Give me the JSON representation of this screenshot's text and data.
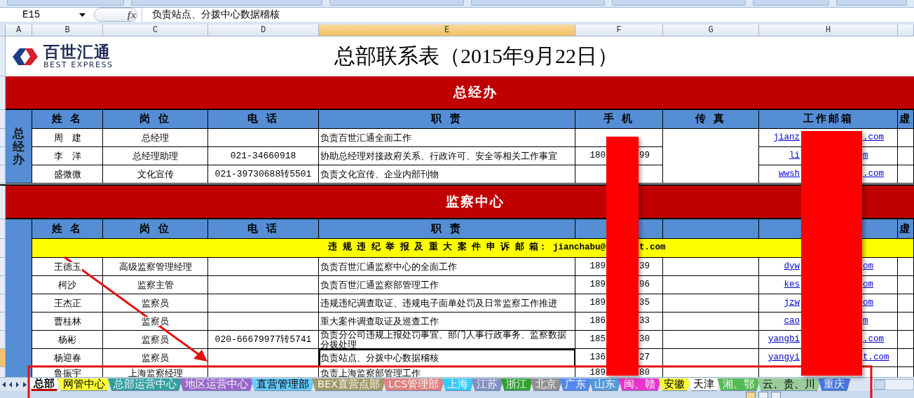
{
  "formula_bar": {
    "cell_ref": "E15",
    "fx": "fx",
    "content": "负责站点、分拨中心数据稽核"
  },
  "columns": [
    {
      "label": "A",
      "selected": false
    },
    {
      "label": "B",
      "selected": false
    },
    {
      "label": "C",
      "selected": false
    },
    {
      "label": "D",
      "selected": false
    },
    {
      "label": "E",
      "selected": true
    },
    {
      "label": "F",
      "selected": false
    },
    {
      "label": "G",
      "selected": false
    },
    {
      "label": "H",
      "selected": false
    }
  ],
  "logo": {
    "name": "百世汇通",
    "tagline": "BEST EXPRESS"
  },
  "title": "总部联系表（2015年9月22日）",
  "sections": [
    {
      "kind": "office",
      "title": "总经办",
      "side_label": "总经办",
      "headers": {
        "name": "姓 名",
        "position": "岗 位",
        "phone": "电 话",
        "duty": "职 责",
        "mobile": "手 机",
        "fax": "传 真",
        "email": "工作邮箱",
        "column_i": "虚"
      },
      "rows": [
        {
          "name": "周　建",
          "position": "总经理",
          "duty": "负责百世汇通全面工作",
          "email": [
            "jianz",
            ".com"
          ],
          "selected": false
        },
        {
          "name": "李　洋",
          "position": "总经理助理",
          "phone": "021-34660918",
          "duty": "协助总经理对接政府关系、行政许可、安全等相关工作事宜",
          "mobile": [
            "180",
            "99"
          ],
          "email": [
            "li",
            "m"
          ],
          "selected": false
        },
        {
          "name": "盛微微",
          "position": "文化宣传",
          "phone": "021-39730688转5501",
          "duty": "负责文化宣传、企业内部刊物",
          "email": [
            "wwsh",
            ".com"
          ],
          "selected": false
        }
      ]
    },
    {
      "kind": "supervision",
      "title": "监察中心",
      "headers": {
        "name": "姓 名",
        "position": "岗 位",
        "phone": "电 话",
        "duty": "职 责",
        "column_i": "虚"
      },
      "notice": [
        "违 规 违 纪 举 报 及 重 大 案 件 申 诉 邮 箱： jianchabu@",
        "t.com"
      ],
      "rows": [
        {
          "name": "王德玉",
          "position": "高级监察管理经理",
          "duty": "负责百世汇通监察中心的全面工作",
          "mobile": [
            "189",
            "39"
          ],
          "email": [
            "dyw",
            "om"
          ],
          "selected": false
        },
        {
          "name": "柯沙",
          "position": "监察主管",
          "duty": "负责百世汇通监察部管理工作",
          "mobile": [
            "189",
            "96"
          ],
          "email": [
            "kes",
            "om"
          ],
          "selected": false
        },
        {
          "name": "王杰正",
          "position": "监察员",
          "duty": "违规违纪调查取证、违规电子面单处罚及日常监察工作推进",
          "mobile": [
            "189",
            "35"
          ],
          "email": [
            "jzw",
            "om"
          ],
          "selected": false
        },
        {
          "name": "曹桂林",
          "position": "监察员",
          "duty": "重大案件调查取证及巡查工作",
          "mobile": [
            "186",
            "33"
          ],
          "email": [
            "cao",
            "m"
          ],
          "selected": false
        },
        {
          "name": "杨彬",
          "position": "监察员",
          "phone": "020-66679977转5741",
          "duty": "负责分公司违规上报处罚事宜、部门人事行政事务、监察数据分拨处理",
          "mobile": [
            "185",
            "30"
          ],
          "email": [
            "yangbi",
            ".com"
          ],
          "selected": false
        },
        {
          "name": "杨迎春",
          "position": "监察员",
          "duty": "负责站点、分拨中心数据稽核",
          "mobile": [
            "136",
            "27"
          ],
          "email": [
            "yangyi",
            "t.com"
          ],
          "selected": true
        },
        {
          "name": "鲁振宇",
          "position": "上海监察经理",
          "duty": "负责上海监察部管理工作",
          "mobile": [
            "189",
            "80"
          ],
          "selected": false
        }
      ]
    }
  ],
  "tabs": [
    {
      "label": "总部",
      "color": "#ffffff",
      "selected": true
    },
    {
      "label": "网管中心",
      "color": "#ffff33",
      "selected": false
    },
    {
      "label": "总部运营中心",
      "color": "#33a0a0",
      "selected": false
    },
    {
      "label": "地区运营中心",
      "color": "#9966cc",
      "selected": false
    },
    {
      "label": "直营管理部",
      "color": "#66ccff",
      "selected": false
    },
    {
      "label": "BEX直营点部",
      "color": "#a09a66",
      "selected": false
    },
    {
      "label": "LCS管理部",
      "color": "#e08080",
      "selected": false
    },
    {
      "label": "上海",
      "color": "#33ccff",
      "selected": false
    },
    {
      "label": "江苏",
      "color": "#8090c0",
      "selected": false
    },
    {
      "label": "浙江",
      "color": "#33a033",
      "selected": false
    },
    {
      "label": "北京",
      "color": "#909090",
      "selected": false
    },
    {
      "label": "广东",
      "color": "#5588ee",
      "selected": false
    },
    {
      "label": "山东",
      "color": "#5599dd",
      "selected": false
    },
    {
      "label": "闽、赣",
      "color": "#ee33cc",
      "selected": false
    },
    {
      "label": "安徽",
      "color": "#ffff33",
      "selected": false
    },
    {
      "label": "天津",
      "color": "#ffffff",
      "selected": false
    },
    {
      "label": "湘、鄂",
      "color": "#55bb55",
      "selected": false
    },
    {
      "label": "云、贵、川",
      "color": "#99cc99",
      "selected": false
    },
    {
      "label": "重庆",
      "color": "#4477dd",
      "selected": false
    }
  ]
}
